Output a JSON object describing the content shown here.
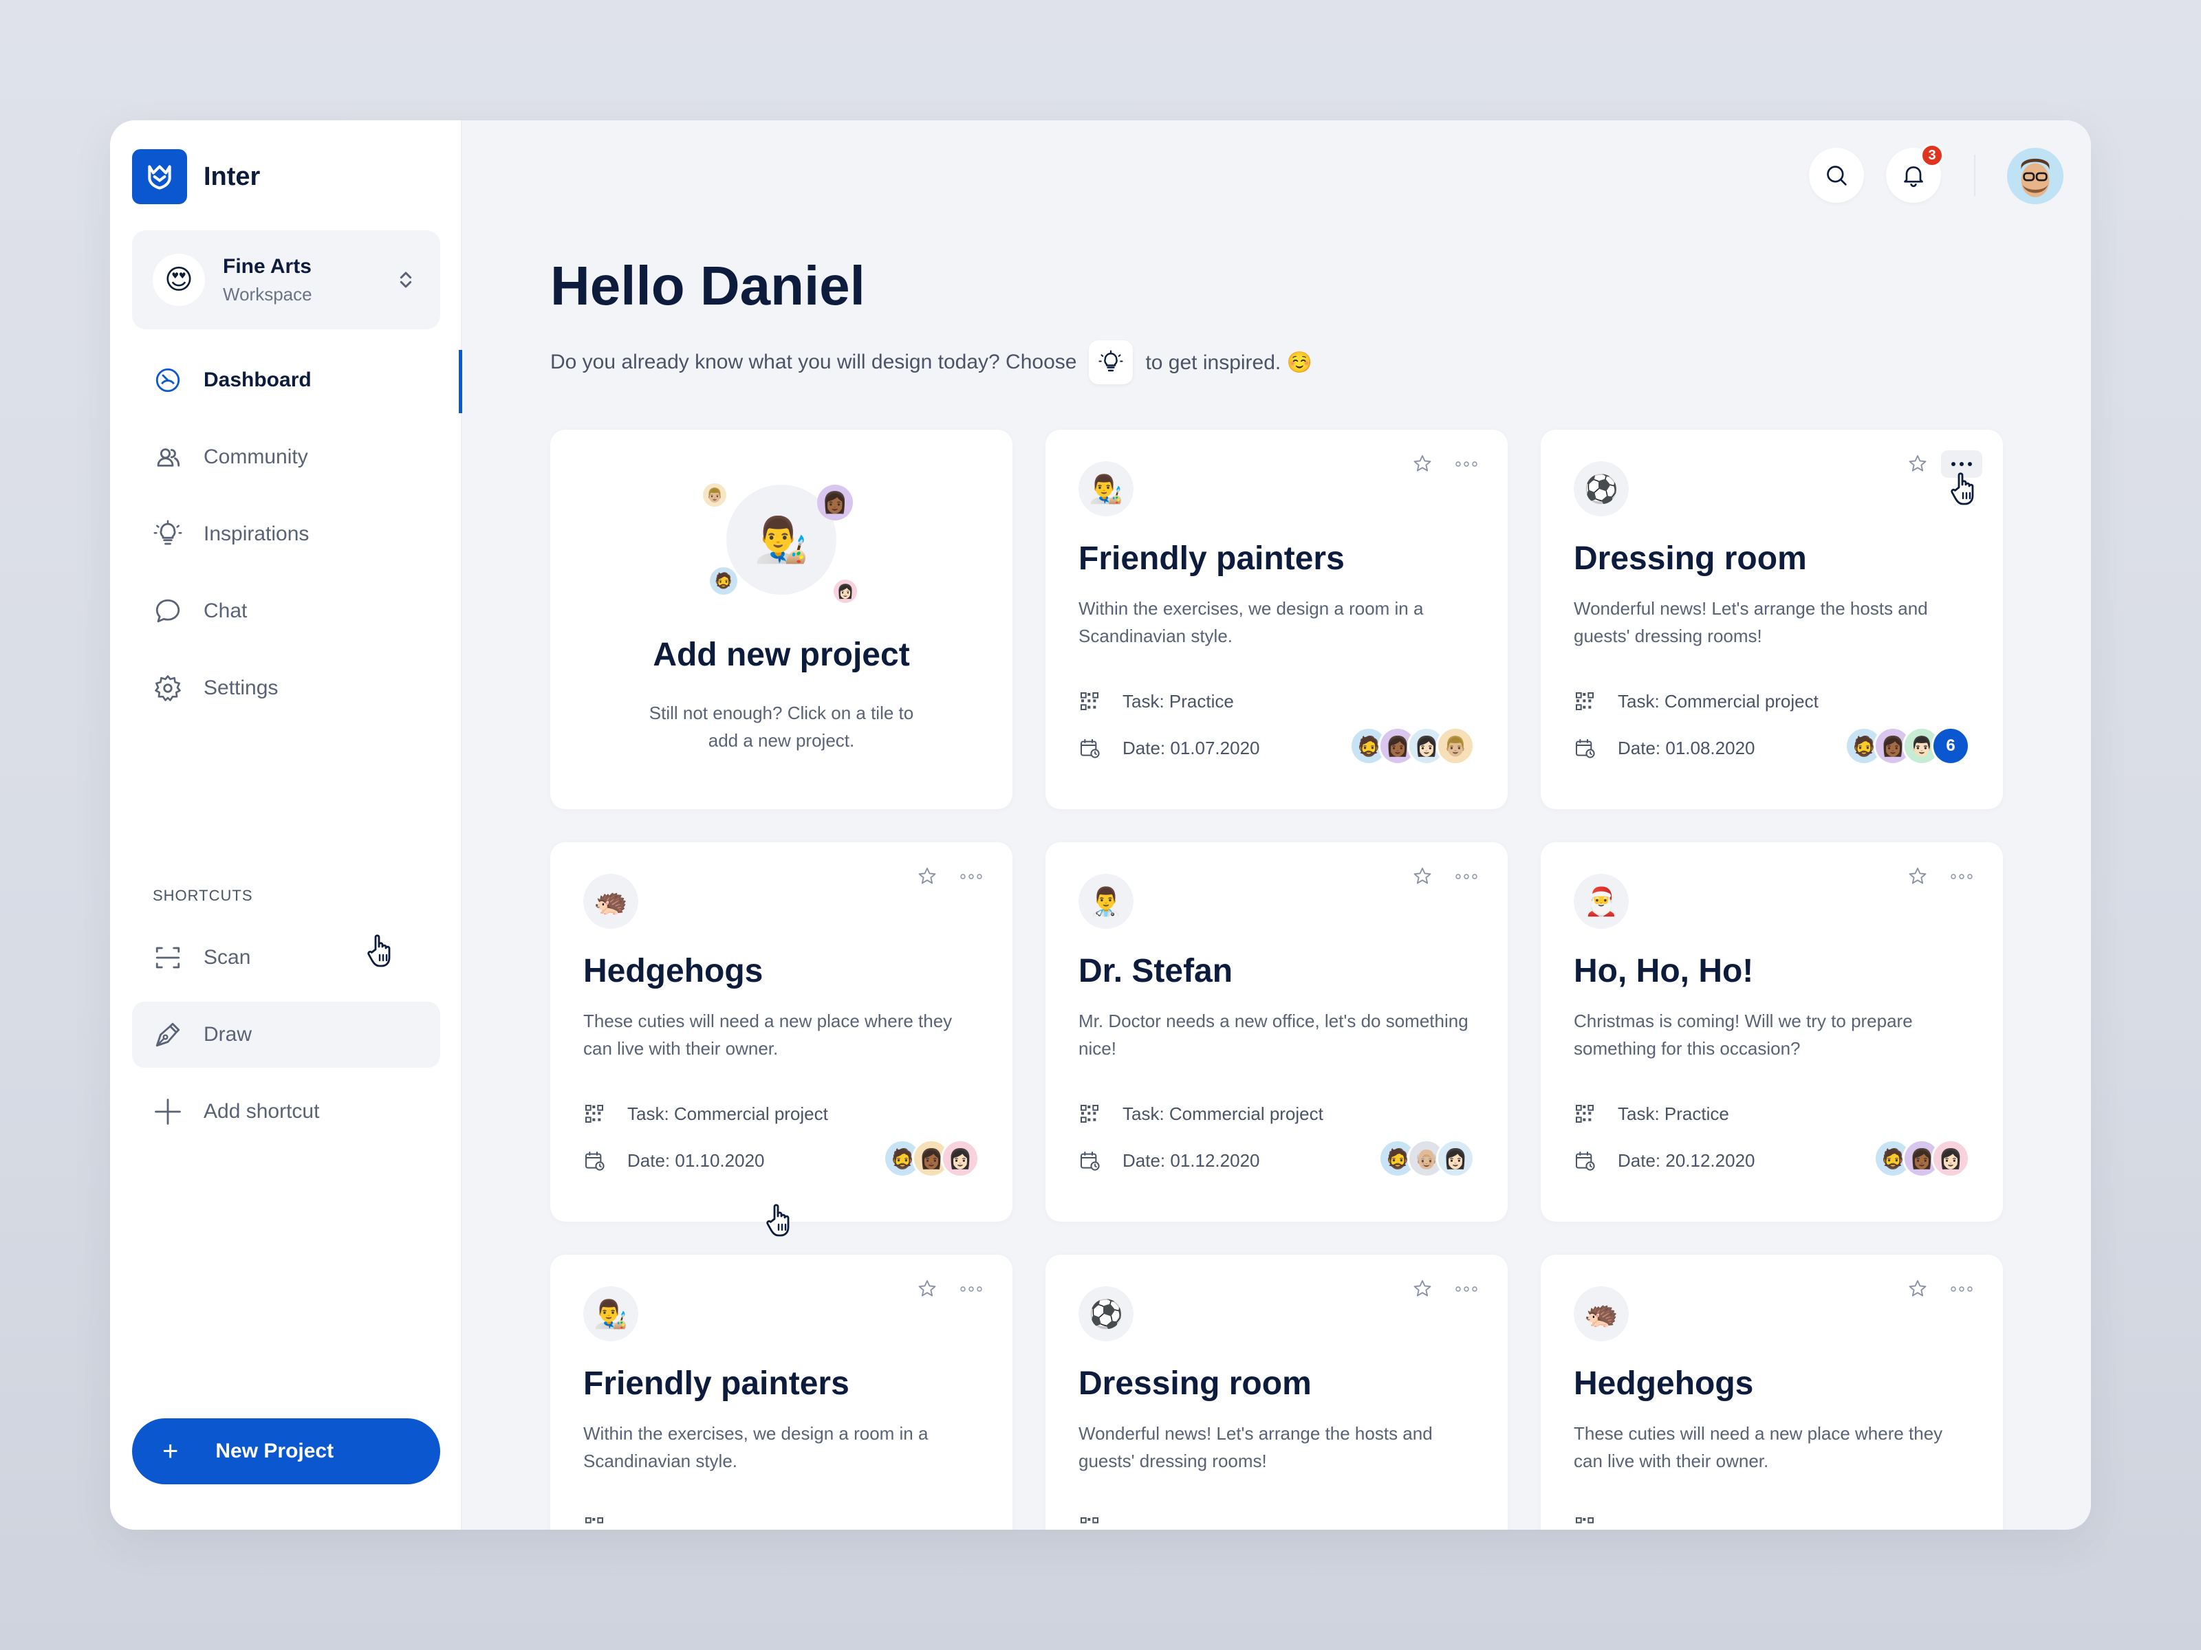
{
  "brand": {
    "name": "Inter"
  },
  "workspace": {
    "name": "Fine Arts",
    "subtitle": "Workspace",
    "emoji": "😍"
  },
  "nav": [
    {
      "label": "Dashboard",
      "icon": "dashboard-icon"
    },
    {
      "label": "Community",
      "icon": "community-icon"
    },
    {
      "label": "Inspirations",
      "icon": "lightbulb-icon"
    },
    {
      "label": "Chat",
      "icon": "chat-icon"
    },
    {
      "label": "Settings",
      "icon": "gear-icon"
    }
  ],
  "shortcuts_label": "SHORTCUTS",
  "shortcuts": [
    {
      "label": "Scan",
      "icon": "scan-icon"
    },
    {
      "label": "Draw",
      "icon": "pen-icon"
    },
    {
      "label": "Add shortcut",
      "icon": "plus-icon"
    }
  ],
  "new_project_button": {
    "plus": "+",
    "label": "New Project"
  },
  "topbar": {
    "notifications_count": "3"
  },
  "greeting": "Hello Daniel",
  "subline": {
    "before": "Do you already know what you will design today? Choose",
    "after": "to get inspired. ☺️"
  },
  "add_card": {
    "title": "Add new project",
    "description": "Still not enough? Click on a tile to add a new project."
  },
  "cards": [
    {
      "emoji": "👨‍🎨",
      "title": "Friendly painters",
      "description": "Within the exercises, we design a room in a Scandinavian style.",
      "task": "Task: Practice",
      "date": "Date: 01.07.2020",
      "avatars": [
        "🧔",
        "👩🏾",
        "👩🏻",
        "👨🏼"
      ]
    },
    {
      "emoji": "⚽",
      "title": "Dressing room",
      "description": "Wonderful news! Let's arrange the hosts and guests' dressing rooms!",
      "task": "Task: Commercial project",
      "date": "Date: 01.08.2020",
      "avatars": [
        "🧔",
        "👩🏾",
        "👨🏻"
      ],
      "extra_count": "6"
    },
    {
      "emoji": "🦔",
      "title": "Hedgehogs",
      "description": "These cuties will need a new place where they can live with their owner.",
      "task": "Task: Commercial project",
      "date": "Date: 01.10.2020",
      "avatars": [
        "🧔",
        "👩🏾",
        "👩🏻"
      ]
    },
    {
      "emoji": "👨‍⚕️",
      "title": "Dr. Stefan",
      "description": "Mr. Doctor needs a new office, let's do something nice!",
      "task": "Task: Commercial project",
      "date": "Date: 01.12.2020",
      "avatars": [
        "🧔",
        "👴🏼",
        "👩🏻"
      ]
    },
    {
      "emoji": "🎅",
      "title": "Ho, Ho, Ho!",
      "description": "Christmas is coming! Will we try to prepare something for this occasion?",
      "task": "Task: Practice",
      "date": "Date: 20.12.2020",
      "avatars": [
        "🧔",
        "👩🏾",
        "👩🏻"
      ]
    },
    {
      "emoji": "👨‍🎨",
      "title": "Friendly painters",
      "description": "Within the exercises, we design a room in a Scandinavian style."
    },
    {
      "emoji": "⚽",
      "title": "Dressing room",
      "description": "Wonderful news! Let's arrange the hosts and guests' dressing rooms!"
    },
    {
      "emoji": "🦔",
      "title": "Hedgehogs",
      "description": "These cuties will need a new place where they can live with their owner."
    }
  ],
  "colors": {
    "accent": "#0b57d0",
    "badge": "#e0341f",
    "text": "#0d1b3d",
    "muted": "#5a6275"
  }
}
